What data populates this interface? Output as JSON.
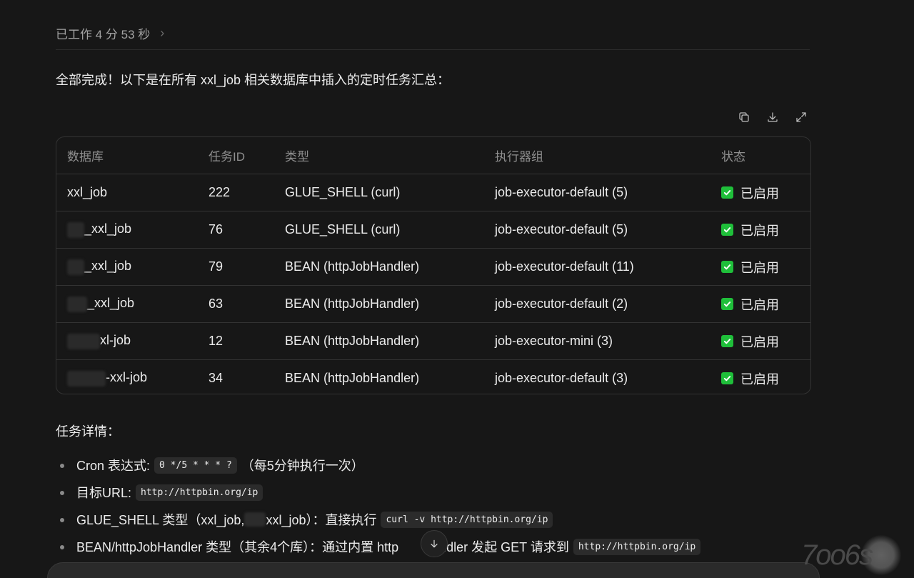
{
  "worked": {
    "label": "已工作 4 分 53 秒",
    "chevron": "›"
  },
  "summary": "全部完成！以下是在所有 xxl_job 相关数据库中插入的定时任务汇总：",
  "table": {
    "actions": [
      "copy-icon",
      "download-icon",
      "expand-icon"
    ],
    "headers": [
      "数据库",
      "任务ID",
      "类型",
      "执行器组",
      "状态"
    ],
    "rows": [
      {
        "db": "xxl_job",
        "id": "222",
        "type": "GLUE_SHELL (curl)",
        "group": "job-executor-default (5)",
        "status": "已启用"
      },
      {
        "db": "_xxl_job",
        "id": "76",
        "type": "GLUE_SHELL (curl)",
        "group": "job-executor-default (5)",
        "status": "已启用"
      },
      {
        "db": "_xxl_job",
        "id": "79",
        "type": "BEAN (httpJobHandler)",
        "group": "job-executor-default (11)",
        "status": "已启用"
      },
      {
        "db": "_xxl_job",
        "id": "63",
        "type": "BEAN (httpJobHandler)",
        "group": "job-executor-default (2)",
        "status": "已启用"
      },
      {
        "db": "xl-job",
        "id": "12",
        "type": "BEAN (httpJobHandler)",
        "group": "job-executor-mini (3)",
        "status": "已启用"
      },
      {
        "db": "-xxl-job",
        "id": "34",
        "type": "BEAN (httpJobHandler)",
        "group": "job-executor-default (3)",
        "status": "已启用"
      }
    ]
  },
  "details": {
    "title": "任务详情：",
    "items": [
      {
        "prefix": "Cron 表达式:",
        "code": "0 */5 * * * ?",
        "suffix": "（每5分钟执行一次）"
      },
      {
        "prefix": "目标URL:",
        "code": "http://httpbin.org/ip",
        "suffix": ""
      },
      {
        "prefix": "GLUE_SHELL 类型（xxl_job,",
        "mid": "xxl_job）：直接执行",
        "code": "curl -v http://httpbin.org/ip",
        "suffix": ""
      },
      {
        "prefix": "BEAN/httpJobHandler 类型（其余4个库）：通过内置 http",
        "mid": "Handler 发起 GET 请求到",
        "code": "http://httpbin.org/ip",
        "suffix": ""
      }
    ]
  },
  "watermark": "7oo6s",
  "colors": {
    "background": "#171717",
    "status_green": "#1fbf3a",
    "code_bg": "#2b2b2b"
  }
}
